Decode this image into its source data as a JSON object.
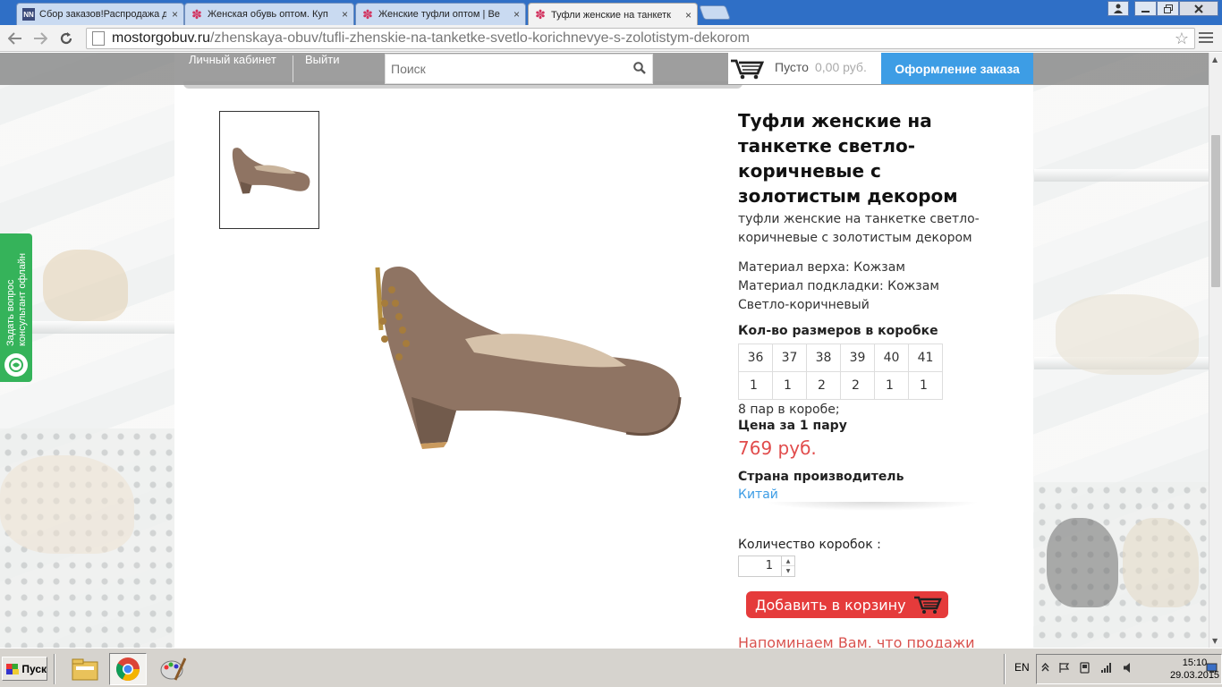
{
  "browser": {
    "tabs": [
      {
        "label": "Сбор заказов!Распродажа д",
        "favicon": "NN",
        "active": false
      },
      {
        "label": "Женская обувь оптом. Куп",
        "favicon": "star-icon",
        "active": false
      },
      {
        "label": "Женские туфли оптом | Ве",
        "favicon": "star-icon",
        "active": false
      },
      {
        "label": "Туфли женские на танкетк",
        "favicon": "star-icon",
        "active": true
      }
    ],
    "url_host": "mostorgobuv.ru",
    "url_path": "/zhenskaya-obuv/tufli-zhenskie-na-tanketke-svetlo-korichnevye-s-zolotistym-dekorom",
    "tab_close_glyph": "×"
  },
  "header": {
    "account_link": "Личный кабинет",
    "logout_link": "Выйти",
    "search_placeholder": "Поиск",
    "cart_status": "Пусто",
    "cart_amount": "0,00 руб.",
    "checkout_button": "Оформление заказа"
  },
  "consultant": {
    "line1": "Задать вопрос",
    "line2": "консультант офлайн"
  },
  "product": {
    "title": "Туфли женские на танкетке светло-коричневые с золотистым декором",
    "subtitle": "туфли женские на танкетке светло-коричневые с золотистым декором",
    "material_upper": "Материал верха: Кожзам",
    "material_lining": "Материал подкладки: Кожзам",
    "color": "Светло-коричневый",
    "sizes_heading": "Кол-во размеров в коробке",
    "sizes": [
      "36",
      "37",
      "38",
      "39",
      "40",
      "41"
    ],
    "size_counts": [
      "1",
      "1",
      "2",
      "2",
      "1",
      "1"
    ],
    "pairs_per_box": "8 пар в коробе;",
    "price_heading": "Цена за 1 пару",
    "price": "769 руб.",
    "country_heading": "Страна производитель",
    "country": "Китай",
    "quantity_label": "Количество коробок :",
    "quantity_value": "1",
    "add_to_cart": "Добавить в корзину",
    "reminder": "Напоминаем Вам, что продажи"
  },
  "taskbar": {
    "start_label": "Пуск",
    "language": "EN",
    "time": "15:10",
    "date": "29.03.2015"
  },
  "colors": {
    "accent_blue": "#3d9de5",
    "price_red": "#e14c4c",
    "cart_button_red": "#e53b3b",
    "consultant_green": "#35b35a",
    "shoe_brown": "#8f7463"
  }
}
